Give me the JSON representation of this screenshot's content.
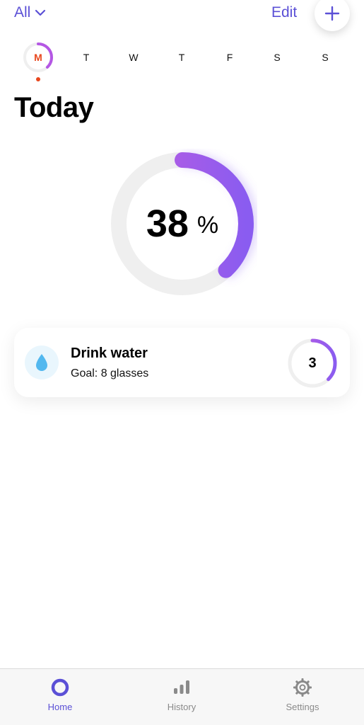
{
  "header": {
    "filter_label": "All",
    "edit_label": "Edit",
    "add_icon": "plus-icon"
  },
  "week": {
    "days": [
      "M",
      "T",
      "W",
      "T",
      "F",
      "S",
      "S"
    ],
    "active_index": 0,
    "active_day_progress": 0.38
  },
  "page_title": "Today",
  "overall": {
    "percent_value": "38",
    "percent_unit": "%",
    "progress": 0.38
  },
  "habit": {
    "icon": "water-drop-icon",
    "name": "Drink water",
    "goal": "Goal: 8 glasses",
    "count": "3",
    "progress": 0.375
  },
  "tabs": [
    {
      "label": "Home",
      "icon": "home-ring-icon",
      "active": true
    },
    {
      "label": "History",
      "icon": "bar-chart-icon",
      "active": false
    },
    {
      "label": "Settings",
      "icon": "gear-icon",
      "active": false
    }
  ],
  "colors": {
    "accent": "#5b50d6",
    "progress_start": "#c05ae0",
    "progress_end": "#8a5cf0",
    "today_marker": "#e8471d",
    "track": "#efefef"
  }
}
